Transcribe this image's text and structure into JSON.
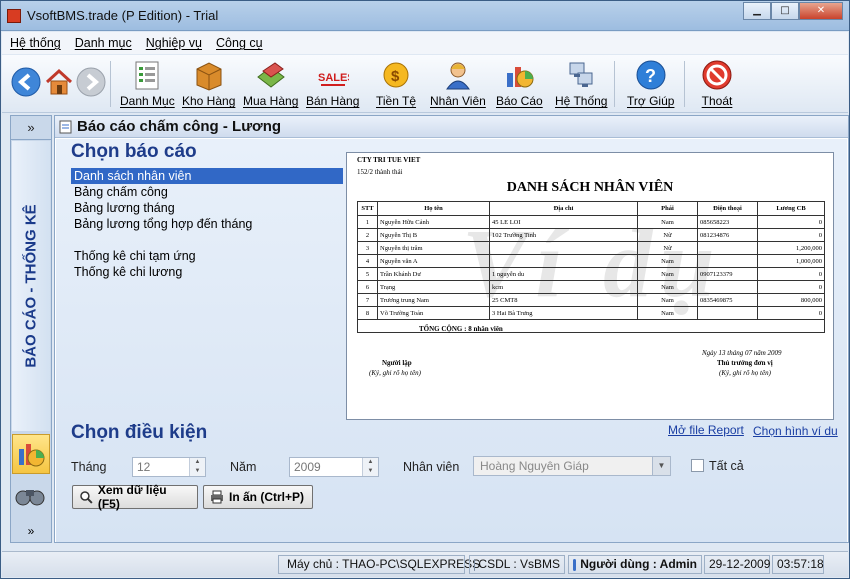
{
  "window": {
    "title": "VsoftBMS.trade (P Edition) - Trial",
    "btn_min": "▁",
    "btn_max": "□",
    "btn_close": "✕"
  },
  "menu": [
    "Hệ thống",
    "Danh mục",
    "Nghiệp vụ",
    "Công cụ"
  ],
  "toolbar": {
    "danh_muc": "Danh Mục",
    "kho_hang": "Kho Hàng",
    "mua_hang": "Mua Hàng",
    "ban_hang": "Bán Hàng",
    "tien_te": "Tiền Tệ",
    "nhan_vien": "Nhân Viên",
    "bao_cao": "Báo Cáo",
    "he_thong": "Hệ Thống",
    "tro_giup": "Trợ Giúp",
    "thoat": "Thoát"
  },
  "sidebar": {
    "expand": "»",
    "label": "BÁO CÁO - THỐNG KÊ",
    "more": "»"
  },
  "header": {
    "title": "Báo cáo chấm công - Lương"
  },
  "report_section": {
    "title": "Chọn báo cáo"
  },
  "reports": [
    "Danh sách nhân viên",
    "Bảng chấm công",
    "Bảng lương tháng",
    "Bảng lương tổng hợp đến tháng"
  ],
  "reports2": [
    "Thống kê chi tạm ứng",
    "Thống kê chi lương"
  ],
  "preview": {
    "company": "CTY TRI TUE VIET",
    "address": "152/2 thành thái",
    "title": "DANH SÁCH NHÂN VIÊN",
    "watermark": "Ví dụ",
    "headers": [
      "STT",
      "Họ tên",
      "Địa chỉ",
      "Phái",
      "Điện thoại",
      "Lương CB"
    ],
    "rows": [
      [
        "1",
        "Nguyễn Hữu Cảnh",
        "45 LE LOI",
        "Nam",
        "085658223",
        "0"
      ],
      [
        "2",
        "Nguyễn Thị B",
        "102 Trường Tinh",
        "Nữ",
        "081234876",
        "0"
      ],
      [
        "3",
        "Nguyễn thị trâm",
        "",
        "Nữ",
        "",
        "1,200,000"
      ],
      [
        "4",
        "Nguyễn văn A",
        "",
        "Nam",
        "",
        "1,000,000"
      ],
      [
        "5",
        "Trần Khánh Dư",
        "1 nguyễn du",
        "Nam",
        "0907123379",
        "0"
      ],
      [
        "6",
        "Trạng",
        "kcm",
        "Nam",
        "",
        "0"
      ],
      [
        "7",
        "Trương trung Nam",
        "25 CMT8",
        "Nam",
        "0835469875",
        "800,000"
      ],
      [
        "8",
        "Võ Trường Toản",
        "3 Hai Bà Trưng",
        "Nam",
        "",
        "0"
      ]
    ],
    "total": "TỔNG CỘNG :  8 nhân viên",
    "signer_left": "Người lập",
    "signer_left_note": "(Ký, ghi rõ họ tên)",
    "date": "Ngày 13 tháng 07 năm 2009",
    "signer_right": "Thủ trưởng đơn vị",
    "signer_right_note": "(Ký, ghi rõ họ tên)"
  },
  "links": {
    "open_file": "Mở file Report",
    "choose_image": "Chọn hình ví du"
  },
  "condition": {
    "title": "Chọn điều kiện",
    "month_label": "Tháng",
    "month_value": "12",
    "year_label": "Năm",
    "year_value": "2009",
    "employee_label": "Nhân viên",
    "employee_value": "Hoàng Nguyên Giáp",
    "all_label": "Tất cả",
    "all_checked": false,
    "view_button": "Xem dữ liệu (F5)",
    "print_button": "In ấn (Ctrl+P)"
  },
  "status": {
    "server": "Máy chủ : THAO-PC\\SQLEXPRESS",
    "db": "CSDL : VsBMS",
    "user": "Người dùng : Admin",
    "date": "29-12-2009",
    "time": "03:57:18"
  }
}
